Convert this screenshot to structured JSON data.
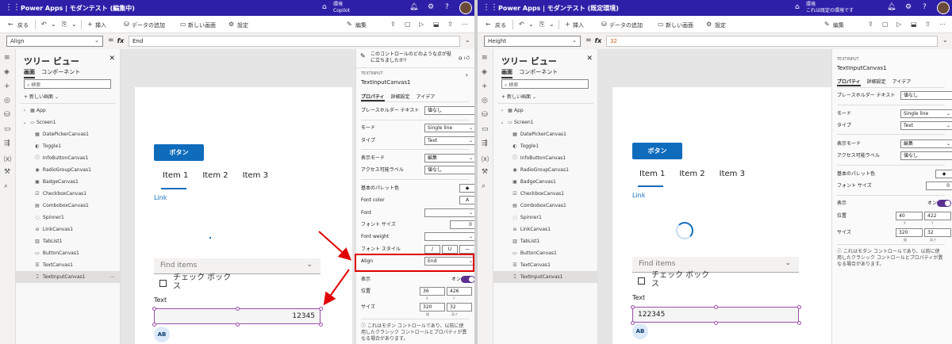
{
  "left": {
    "app_title": "Power Apps | モダンテスト (編集中)",
    "env_label": "環境",
    "env_name": "Copilot",
    "cmd": {
      "back": "戻る",
      "insert": "挿入",
      "add_data": "データの追加",
      "new_screen": "新しい画面",
      "settings": "設定",
      "edit": "編集"
    },
    "property": "Align",
    "formula": "End",
    "tree": {
      "title": "ツリー ビュー",
      "tab_screen": "画面",
      "tab_component": "コンポーネント",
      "search_placeholder": "検索",
      "new_screen": "新しい画面",
      "nodes": [
        "App",
        "Screen1",
        "DatePickerCanvas1",
        "Toggle1",
        "InfoButtonCanvas1",
        "RadioGroupCanvas1",
        "BadgeCanvas1",
        "CheckboxCanvas1",
        "ComboboxCanvas1",
        "Spinner1",
        "LinkCanvas1",
        "TabList1",
        "ButtonCanvas1",
        "TextCanvas1",
        "TextInputCanvas1"
      ]
    },
    "canvas": {
      "button": "ボタン",
      "tabs": [
        "Item 1",
        "Item 2",
        "Item 3"
      ],
      "link": "Link",
      "combo_placeholder": "Find items",
      "checkbox_line1": "チェック ボック",
      "checkbox_line2": "ス",
      "text_label": "Text",
      "input_value": "12345",
      "badge": "AB"
    },
    "panel": {
      "copilot_line1": "このコントロールのどのような点が役",
      "copilot_line2": "に立ちましたか?",
      "type": "TEXTINPUT",
      "name": "TextInputCanvas1",
      "tabs": [
        "プロパティ",
        "詳細設定",
        "アイデア"
      ],
      "placeholder_label": "プレースホルダー テキスト",
      "placeholder_value": "値なし",
      "mode_label": "モード",
      "mode_value": "Single line",
      "type_label": "タイプ",
      "type_value": "Text",
      "display_mode_label": "表示モード",
      "display_mode_value": "編集",
      "access_label": "アクセス可能ラベル",
      "access_value": "値なし",
      "palette_label": "基本のパレット色",
      "font_color_label": "Font color",
      "font_color_value": "A",
      "font_label": "Font",
      "font_size_label": "フォント サイズ",
      "font_size_value": "0",
      "font_weight_label": "Font weight",
      "font_style_label": "フォント スタイル",
      "font_style_i": "/",
      "font_style_u": "U",
      "font_style_s": "—",
      "align_label": "Align",
      "align_value": "End",
      "visible_label": "表示",
      "visible_value": "オン",
      "position_label": "位置",
      "pos_x": "36",
      "pos_y": "426",
      "x": "X",
      "y": "Y",
      "size_label": "サイズ",
      "width": "320",
      "height": "32",
      "w_label": "幅",
      "h_label": "高さ",
      "info": "これはモダン コントロールであり、以前に使用したクラシック コントロールとプロパティが異なる場合があります。"
    }
  },
  "right": {
    "app_title": "Power Apps | モダンテスト (既定環境)",
    "env_label": "環境",
    "env_name": "これは既定の環境です",
    "cmd": {
      "back": "戻る",
      "insert": "挿入",
      "add_data": "データの追加",
      "new_screen": "新しい画面",
      "settings": "設定",
      "edit": "編集"
    },
    "property": "Height",
    "formula": "32",
    "tree": {
      "title": "ツリー ビュー",
      "tab_screen": "画面",
      "tab_component": "コンポーネント",
      "search_placeholder": "検索",
      "new_screen": "新しい画面",
      "nodes": [
        "App",
        "Screen1",
        "DatePickerCanvas1",
        "Toggle1",
        "InfoButtonCanvas1",
        "RadioGroupCanvas1",
        "BadgeCanvas1",
        "CheckboxCanvas1",
        "ComboboxCanvas1",
        "Spinner1",
        "LinkCanvas1",
        "TabList1",
        "ButtonCanvas1",
        "TextCanvas1",
        "TextInputCanvas1"
      ]
    },
    "canvas": {
      "button": "ボタン",
      "tabs": [
        "Item 1",
        "Item 2",
        "Item 3"
      ],
      "link": "Link",
      "combo_placeholder": "Find items",
      "checkbox_line1": "チェック ボック",
      "checkbox_line2": "ス",
      "text_label": "Text",
      "input_value": "122345",
      "badge": "AB"
    },
    "panel": {
      "type": "TEXTINPUT",
      "name": "TextInputCanvas1",
      "tabs": [
        "プロパティ",
        "詳細設定",
        "アイデア"
      ],
      "placeholder_label": "プレースホルダー テキスト",
      "placeholder_value": "値なし",
      "mode_label": "モード",
      "mode_value": "Single line",
      "type_label": "タイプ",
      "type_value": "Text",
      "display_mode_label": "表示モード",
      "display_mode_value": "編集",
      "access_label": "アクセス可能ラベル",
      "access_value": "値なし",
      "palette_label": "基本のパレット色",
      "font_size_label": "フォント サイズ",
      "font_size_value": "0",
      "visible_label": "表示",
      "visible_value": "オン",
      "position_label": "位置",
      "pos_x": "40",
      "pos_y": "422",
      "x": "X",
      "y": "Y",
      "size_label": "サイズ",
      "width": "320",
      "height": "32",
      "w_label": "幅",
      "h_label": "高さ",
      "info": "これはモダン コントロールであり、以前に使用したクラシック コントロールとプロパティが異なる場合があります。"
    }
  },
  "colors": {
    "titlebar": "#2e1fa8",
    "accent": "#0f6cbd",
    "selection": "#9b4fa7",
    "highlight": "#e00000",
    "toggle": "#5b2f91"
  }
}
